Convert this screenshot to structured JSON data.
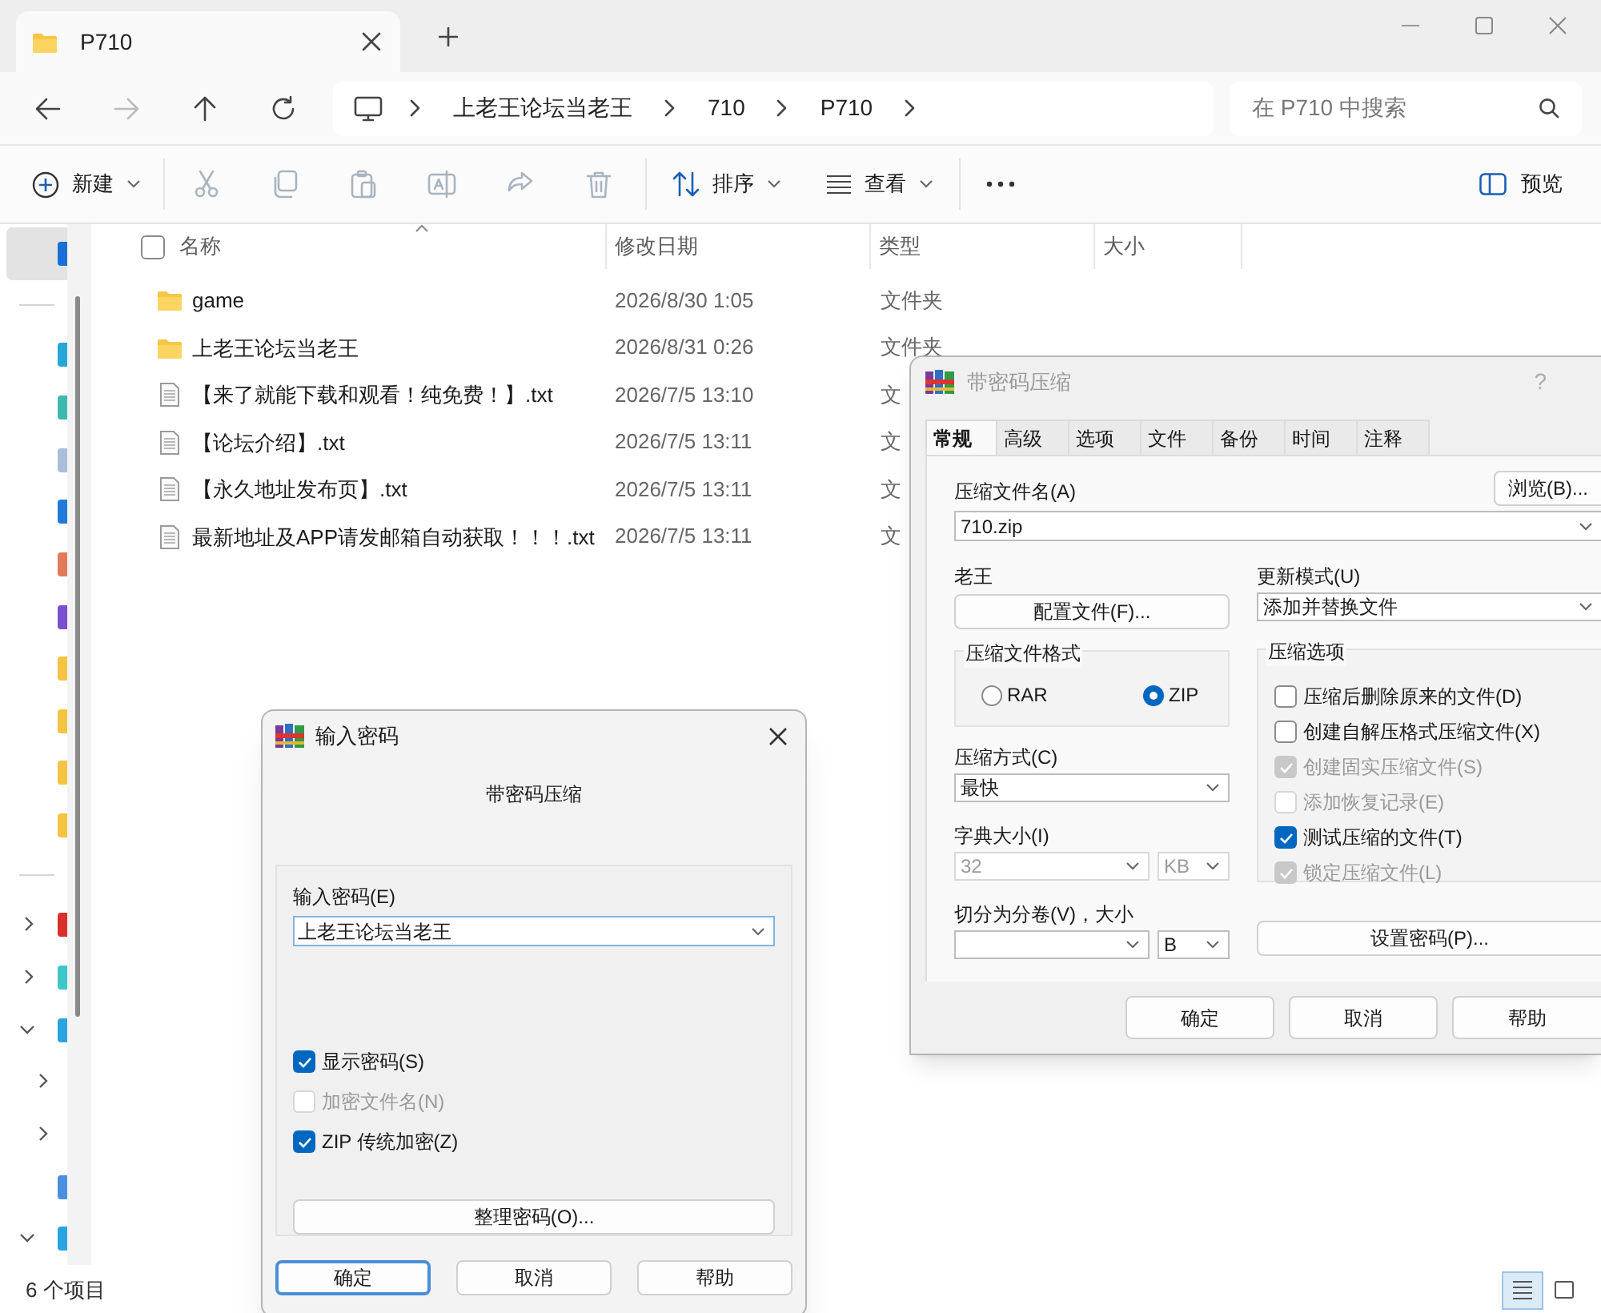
{
  "explorer": {
    "tab": {
      "title": "P710"
    },
    "nav": {
      "breadcrumbs": [
        "上老王论坛当老王",
        "710",
        "P710"
      ],
      "search_placeholder": "在 P710 中搜索"
    },
    "toolbar": {
      "new": "新建",
      "sort": "排序",
      "view": "查看",
      "preview": "预览"
    },
    "sidebar": [
      {
        "kind": "item",
        "selected": true,
        "color": "#1a6fd6"
      },
      {
        "kind": "divider"
      },
      {
        "kind": "item",
        "selected": false,
        "color": "#27a7d8"
      },
      {
        "kind": "item",
        "selected": false,
        "color": "#3fb8b0"
      },
      {
        "kind": "item",
        "selected": false,
        "color": "#a9bed8"
      },
      {
        "kind": "item",
        "selected": false,
        "color": "#1f7ad8"
      },
      {
        "kind": "item",
        "selected": false,
        "color": "#e27a5a"
      },
      {
        "kind": "item",
        "selected": false,
        "color": "#7a4fd0"
      },
      {
        "kind": "item",
        "selected": false,
        "color": "#f5c242"
      },
      {
        "kind": "item",
        "selected": false,
        "color": "#f5c242"
      },
      {
        "kind": "item",
        "selected": false,
        "color": "#f5c242"
      },
      {
        "kind": "item",
        "selected": false,
        "color": "#f5c242"
      },
      {
        "kind": "divider"
      },
      {
        "kind": "node",
        "selected": false,
        "expanded": false,
        "color": "#d9302c"
      },
      {
        "kind": "node",
        "selected": false,
        "expanded": false,
        "color": "#3cc8c8"
      },
      {
        "kind": "node",
        "selected": false,
        "expanded": true,
        "color": "#2aa4e0",
        "children": [
          {
            "kind": "node",
            "selected": false,
            "expanded": false
          },
          {
            "kind": "node",
            "selected": false,
            "expanded": false
          },
          {
            "kind": "item",
            "selected": false,
            "color": "#4a90e2"
          }
        ]
      },
      {
        "kind": "node",
        "selected": false,
        "expanded": true,
        "color": "#2aa4e0"
      }
    ],
    "select_all": {
      "checked": false
    },
    "columns": [
      "名称",
      "修改日期",
      "类型",
      "大小"
    ],
    "rows": [
      {
        "kind": "folder",
        "name": "game",
        "modified": "2026/8/30 1:05",
        "type": "文件夹"
      },
      {
        "kind": "folder",
        "name": "上老王论坛当老王",
        "modified": "2026/8/31 0:26",
        "type": "文件夹"
      },
      {
        "kind": "file",
        "name": "【来了就能下载和观看！纯免费！】.txt",
        "modified": "2026/7/5 13:10",
        "type": "文"
      },
      {
        "kind": "file",
        "name": "【论坛介绍】.txt",
        "modified": "2026/7/5 13:11",
        "type": "文"
      },
      {
        "kind": "file",
        "name": "【永久地址发布页】.txt",
        "modified": "2026/7/5 13:11",
        "type": "文"
      },
      {
        "kind": "file",
        "name": "最新地址及APP请发邮箱自动获取！！！.txt",
        "modified": "2026/7/5 13:11",
        "type": "文"
      }
    ],
    "status": "6 个项目",
    "views": [
      {
        "kind": "details",
        "selected": true
      },
      {
        "kind": "tiles",
        "selected": false
      }
    ]
  },
  "archive_dialog": {
    "title": "带密码压缩",
    "active": false,
    "help": "?",
    "tabs": [
      {
        "label": "常规",
        "selected": true
      },
      {
        "label": "高级",
        "selected": false
      },
      {
        "label": "选项",
        "selected": false
      },
      {
        "label": "文件",
        "selected": false
      },
      {
        "label": "备份",
        "selected": false
      },
      {
        "label": "时间",
        "selected": false
      },
      {
        "label": "注释",
        "selected": false
      }
    ],
    "archive_name_label": "压缩文件名(A)",
    "browse": "浏览(B)...",
    "archive_name": "710.zip",
    "profile_label": "老王",
    "profile_button": "配置文件(F)...",
    "update_mode_label": "更新模式(U)",
    "update_mode": "添加并替换文件",
    "format_group": "压缩文件格式",
    "formats": [
      {
        "label": "RAR",
        "selected": false
      },
      {
        "label": "ZIP",
        "selected": true
      }
    ],
    "method_label": "压缩方式(C)",
    "method": "最快",
    "dict_label": "字典大小(I)",
    "dict": {
      "value": "32",
      "unit": "KB",
      "disabled": true
    },
    "split_label": "切分为分卷(V)，大小",
    "split_unit": "B",
    "options_group": "压缩选项",
    "options": [
      {
        "label": "压缩后删除原来的文件(D)",
        "checked": false,
        "disabled": false
      },
      {
        "label": "创建自解压格式压缩文件(X)",
        "checked": false,
        "disabled": false
      },
      {
        "label": "创建固实压缩文件(S)",
        "checked": true,
        "disabled": true
      },
      {
        "label": "添加恢复记录(E)",
        "checked": false,
        "disabled": true
      },
      {
        "label": "测试压缩的文件(T)",
        "checked": true,
        "disabled": false
      },
      {
        "label": "锁定压缩文件(L)",
        "checked": true,
        "disabled": true
      }
    ],
    "set_password": "设置密码(P)...",
    "buttons": [
      "确定",
      "取消",
      "帮助"
    ]
  },
  "password_dialog": {
    "title": "输入密码",
    "active": true,
    "subtitle": "带密码压缩",
    "label": "输入密码(E)",
    "value": "上老王论坛当老王",
    "options": [
      {
        "label": "显示密码(S)",
        "checked": true,
        "disabled": false
      },
      {
        "label": "加密文件名(N)",
        "checked": false,
        "disabled": true
      },
      {
        "label": "ZIP 传统加密(Z)",
        "checked": true,
        "disabled": false
      }
    ],
    "organize": "整理密码(O)...",
    "buttons": [
      {
        "label": "确定",
        "focused": true
      },
      {
        "label": "取消",
        "focused": false
      },
      {
        "label": "帮助",
        "focused": false
      }
    ]
  }
}
